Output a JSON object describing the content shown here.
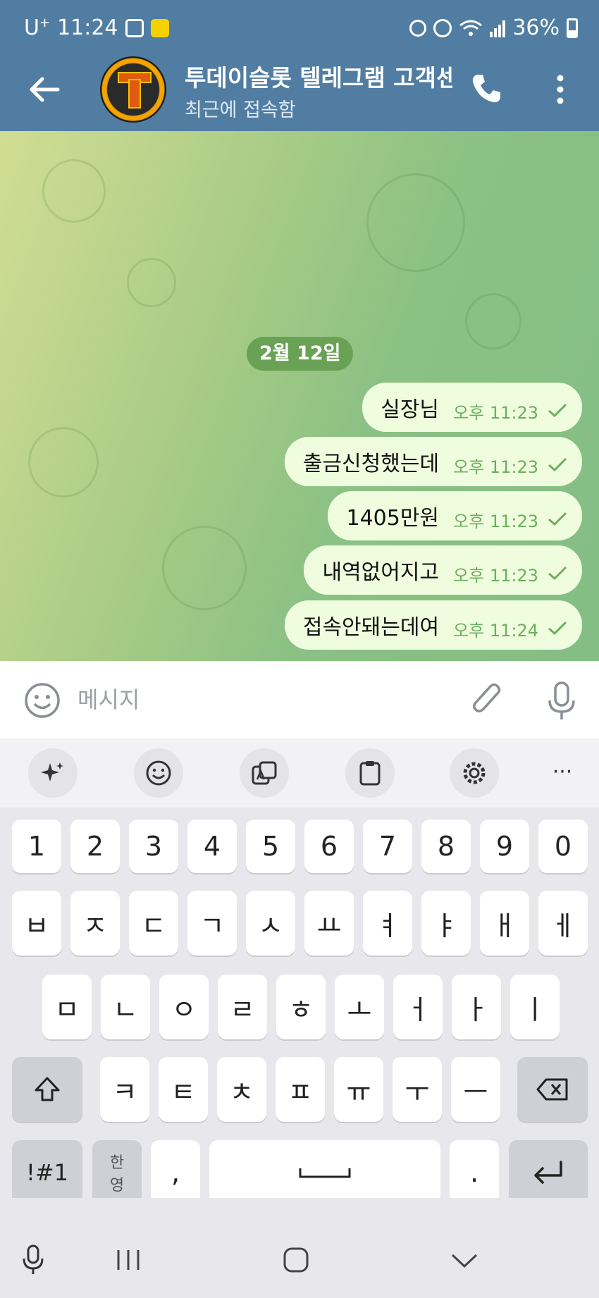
{
  "status_bar": {
    "carrier": "U",
    "carrier_sup": "+",
    "time": "11:24",
    "battery": "36%"
  },
  "header": {
    "title": "투데이슬롯 텔레그램 고객센터",
    "subtitle": "최근에 접속함"
  },
  "chat": {
    "date_chip": "2월 12일",
    "messages": [
      {
        "text": "실장님",
        "time": "오후 11:23",
        "status": "sent"
      },
      {
        "text": "출금신청했는데",
        "time": "오후 11:23",
        "status": "sent"
      },
      {
        "text": "1405만원",
        "time": "오후 11:23",
        "status": "sent"
      },
      {
        "text": "내역없어지고",
        "time": "오후 11:23",
        "status": "sent"
      },
      {
        "text": "접속안돼는데여",
        "time": "오후 11:24",
        "status": "sent"
      }
    ]
  },
  "composer": {
    "placeholder": "메시지",
    "value": ""
  },
  "keyboard": {
    "toolbar": [
      "sparkle-icon",
      "emoji-icon",
      "translate-icon",
      "clipboard-icon",
      "settings-icon",
      "more-icon"
    ],
    "row_numbers": [
      "1",
      "2",
      "3",
      "4",
      "5",
      "6",
      "7",
      "8",
      "9",
      "0"
    ],
    "row1": [
      "ㅂ",
      "ㅈ",
      "ㄷ",
      "ㄱ",
      "ㅅ",
      "ㅛ",
      "ㅕ",
      "ㅑ",
      "ㅐ",
      "ㅔ"
    ],
    "row2": [
      "ㅁ",
      "ㄴ",
      "ㅇ",
      "ㄹ",
      "ㅎ",
      "ㅗ",
      "ㅓ",
      "ㅏ",
      "ㅣ"
    ],
    "row3": [
      "ㅋ",
      "ㅌ",
      "ㅊ",
      "ㅍ",
      "ㅠ",
      "ㅜ",
      "ㅡ"
    ],
    "symbols_key": "!#1",
    "lang_key_top": "한",
    "lang_key_bottom": "영",
    "comma_key": ",",
    "period_key": "."
  },
  "colors": {
    "header_bg": "#517da2",
    "bubble_bg": "#effdde",
    "bubble_time": "#6cae5e",
    "date_chip_bg": "#6aa255"
  }
}
